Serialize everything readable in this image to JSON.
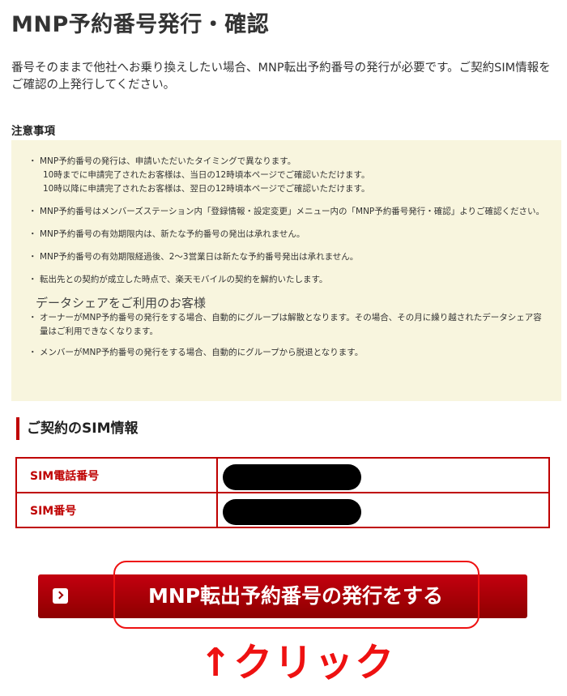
{
  "page": {
    "title": "MNP予約番号発行・確認",
    "intro": "番号そのままで他社へお乗り換えしたい場合、MNP転出予約番号の発行が必要です。ご契約SIM情報をご確認の上発行してください。"
  },
  "notice": {
    "heading": "注意事項",
    "items": [
      {
        "text": "MNP予約番号の発行は、申請いただいたタイミングで異なります。",
        "sub": [
          "10時までに申請完了されたお客様は、当日の12時頃本ページでご確認いただけます。",
          "10時以降に申請完了されたお客様は、翌日の12時頃本ページでご確認いただけます。"
        ]
      },
      {
        "text": "MNP予約番号はメンバーズステーション内「登録情報・設定変更」メニュー内の「MNP予約番号発行・確認」よりご確認ください。"
      },
      {
        "text": "MNP予約番号の有効期限内は、新たな予約番号の発出は承れません。"
      },
      {
        "text": "MNP予約番号の有効期限経過後、2〜3営業日は新たな予約番号発出は承れません。"
      },
      {
        "text": "転出先との契約が成立した時点で、楽天モバイルの契約を解約いたします。"
      }
    ],
    "datashare_heading": "データシェアをご利用のお客様",
    "datashare_items": [
      "オーナーがMNP予約番号の発行をする場合、自動的にグループは解散となります。その場合、その月に繰り越されたデータシェア容量はご利用できなくなります。",
      "メンバーがMNP予約番号の発行をする場合、自動的にグループから脱退となります。"
    ]
  },
  "sim_info": {
    "heading": "ご契約のSIM情報",
    "rows": [
      {
        "label": "SIM電話番号"
      },
      {
        "label": "SIM番号"
      }
    ]
  },
  "action": {
    "button_label": "MNP転出予約番号の発行をする",
    "annotation": "↑クリック"
  },
  "colors": {
    "brand_red": "#bf0000",
    "notice_bg": "#f8f5de",
    "annotation_red": "#ee1111"
  }
}
